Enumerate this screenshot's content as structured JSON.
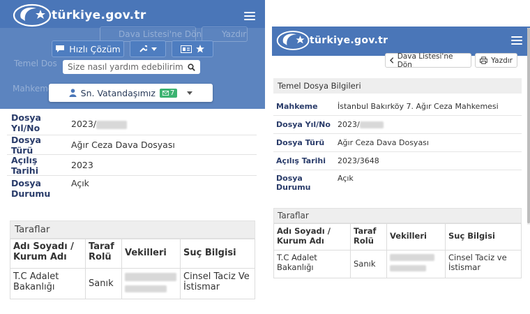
{
  "left": {
    "logo_text": "türkiye.gov.tr",
    "ghost_back": "Dava Listesi'ne Dön",
    "ghost_print": "Yazdır",
    "ghost_temel": "Temel Dos",
    "ghost_mahkeme": "Mahkeme",
    "quick_solution_label": "Hızlı Çözüm",
    "search_placeholder": "Size nasıl yardım edebilirim",
    "citizen_label": "Sn. Vatandaşımız",
    "message_count": "7",
    "rows": [
      {
        "key": "Dosya Yıl/No",
        "value": "2023/"
      },
      {
        "key": "Dosya Türü",
        "value": "Ağır Ceza Dava Dosyası"
      },
      {
        "key": "Açılış Tarihi",
        "value": "2023"
      },
      {
        "key": "Dosya Durumu",
        "value": "Açık"
      }
    ],
    "parties_title": "Taraflar",
    "table_headers": [
      "Adı Soyadı / Kurum Adı",
      "Taraf Rolü",
      "Vekilleri",
      "Suç Bilgisi"
    ],
    "table_row": {
      "name": "T.C Adalet Bakanlığı",
      "role": "Sanık",
      "lawyers": "",
      "crime": "Cinsel Taciz Ve İstismar"
    }
  },
  "right": {
    "logo_text": "türkiye.gov.tr",
    "back_label": "Dava Listesi'ne Dön",
    "print_label": "Yazdır",
    "section_title": "Temel Dosya Bilgileri",
    "rows": [
      {
        "key": "Mahkeme",
        "value": "İstanbul Bakırköy 7. Ağır Ceza Mahkemesi"
      },
      {
        "key": "Dosya Yıl/No",
        "value": "2023/"
      },
      {
        "key": "Dosya Türü",
        "value": "Ağır Ceza Dava Dosyası"
      },
      {
        "key": "Açılış Tarihi",
        "value": "2023/3648"
      },
      {
        "key": "Dosya Durumu",
        "value": "Açık"
      }
    ],
    "parties_title": "Taraflar",
    "table_headers": [
      "Adı Soyadı / Kurum Adı",
      "Taraf Rolü",
      "Vekilleri",
      "Suç Bilgisi"
    ],
    "table_row": {
      "name": "T.C Adalet Bakanlığı",
      "role": "Sanık",
      "lawyers": "",
      "crime": "Cinsel Taciz ve İstismar"
    }
  },
  "colors": {
    "header_blue": "#4a76b8",
    "label_navy": "#2a3c6a",
    "badge_green": "#3cb371"
  }
}
